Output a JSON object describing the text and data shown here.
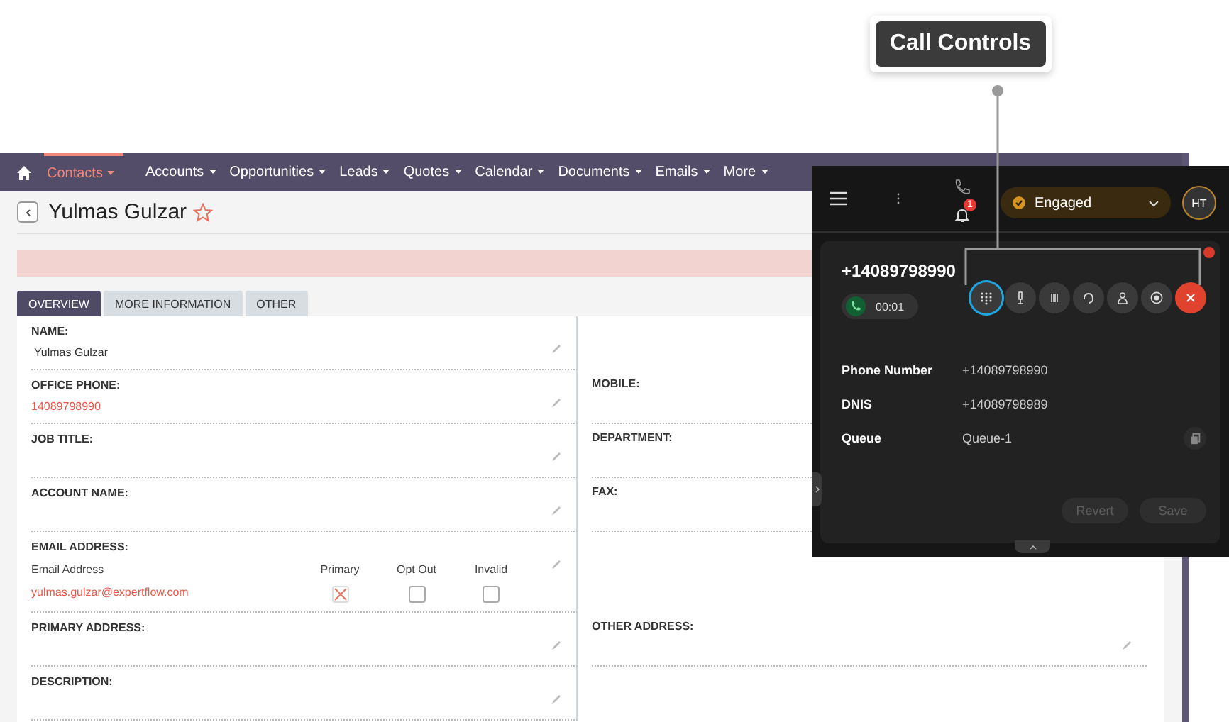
{
  "callout": {
    "label": "Call Controls"
  },
  "nav": {
    "items": [
      {
        "label": "Contacts",
        "selected": true
      },
      {
        "label": "Accounts",
        "selected": false
      },
      {
        "label": "Opportunities",
        "selected": false
      },
      {
        "label": "Leads",
        "selected": false
      },
      {
        "label": "Quotes",
        "selected": false
      },
      {
        "label": "Calendar",
        "selected": false
      },
      {
        "label": "Documents",
        "selected": false
      },
      {
        "label": "Emails",
        "selected": false
      },
      {
        "label": "More",
        "selected": false
      }
    ]
  },
  "record": {
    "title": "Yulmas Gulzar",
    "favorite": false
  },
  "tabs": [
    {
      "label": "OVERVIEW",
      "selected": true
    },
    {
      "label": "MORE INFORMATION",
      "selected": false
    },
    {
      "label": "OTHER",
      "selected": false
    }
  ],
  "rows": [
    {
      "left": {
        "kind": "text",
        "label": "NAME:",
        "value": "Yulmas Gulzar"
      }
    },
    {
      "left": {
        "kind": "link",
        "label": "OFFICE PHONE:",
        "value": "14089798990"
      },
      "right": {
        "label": "MOBILE:"
      }
    },
    {
      "left": {
        "kind": "text",
        "label": "JOB TITLE:"
      },
      "right": {
        "label": "DEPARTMENT:"
      }
    },
    {
      "left": {
        "kind": "text",
        "label": "ACCOUNT NAME:"
      },
      "right": {
        "label": "FAX:"
      }
    },
    {
      "left": {
        "kind": "email",
        "label": "EMAIL ADDRESS:",
        "columns": [
          "Email Address",
          "Primary",
          "Opt Out",
          "Invalid"
        ],
        "email": "yulmas.gulzar@expertflow.com",
        "primary": true,
        "opt_out": false,
        "invalid": false
      }
    },
    {
      "left": {
        "kind": "text",
        "label": "PRIMARY ADDRESS:"
      },
      "right": {
        "label": "OTHER ADDRESS:",
        "editable": true
      }
    },
    {
      "left": {
        "kind": "text",
        "label": "DESCRIPTION:"
      }
    }
  ],
  "panel": {
    "notifications": "1",
    "status": "Engaged",
    "avatar": "HT",
    "number": "+14089798990",
    "timer": "00:01",
    "controls": [
      {
        "kind": "keypad",
        "selected": true
      },
      {
        "kind": "mic",
        "selected": false
      },
      {
        "kind": "hold",
        "selected": false
      },
      {
        "kind": "headset",
        "selected": false
      },
      {
        "kind": "transfer",
        "selected": false
      },
      {
        "kind": "record",
        "selected": false
      },
      {
        "kind": "end",
        "selected": false
      }
    ],
    "info": [
      {
        "label": "Phone Number",
        "value": "+14089798990",
        "copyable": false
      },
      {
        "label": "DNIS",
        "value": "+14089798989",
        "copyable": false
      },
      {
        "label": "Queue",
        "value": "Queue-1",
        "copyable": true
      }
    ],
    "buttons": [
      {
        "label": "Revert",
        "disabled": true
      },
      {
        "label": "Save",
        "disabled": true
      }
    ]
  }
}
